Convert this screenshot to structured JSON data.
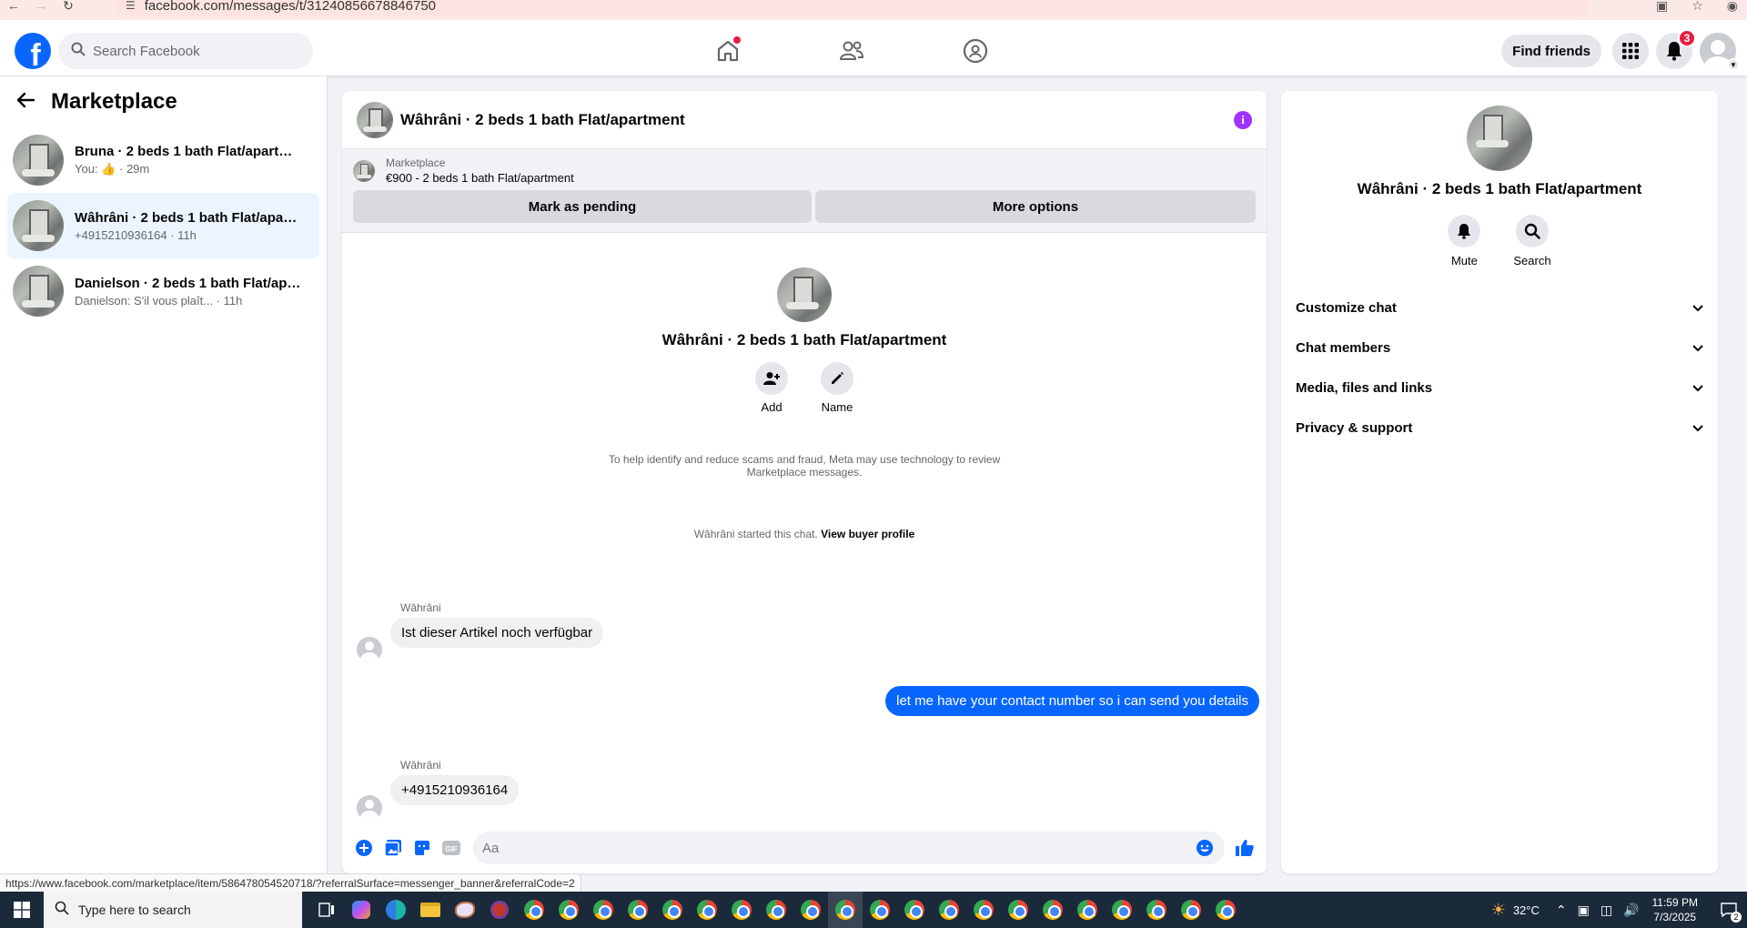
{
  "browser": {
    "url": "facebook.com/messages/t/31240856678846750",
    "status_url": "https://www.facebook.com/marketplace/item/586478054520718/?referralSurface=messenger_banner&referralCode=2"
  },
  "topbar": {
    "search_placeholder": "Search Facebook",
    "find_friends": "Find friends",
    "notifications_count": "3"
  },
  "sidebar": {
    "title": "Marketplace",
    "conversations": [
      {
        "title": "Bruna · 2 beds 1 bath Flat/apartme...",
        "sub_prefix": "You:",
        "sub_time": "· 29m"
      },
      {
        "title": "Wâhrâni · 2 beds 1 bath Flat/apart...",
        "sub": "+4915210936164 · 11h"
      },
      {
        "title": "Danielson · 2 beds 1 bath Flat/apar...",
        "sub": "Danielson: S'il vous plaît... · 11h"
      }
    ]
  },
  "chat": {
    "title": "Wâhrâni · 2 beds 1 bath Flat/apartment",
    "banner_label": "Marketplace",
    "banner_listing": "€900 - 2 beds 1 bath Flat/apartment",
    "mark_pending": "Mark as pending",
    "more_options": "More options",
    "intro_name": "Wâhrâni · 2 beds 1 bath Flat/apartment",
    "intro_add": "Add",
    "intro_name_btn": "Name",
    "started_text": "Wâhrâni started this chat.",
    "view_buyer": "View buyer profile",
    "scam_notice_1": "To help identify and reduce scams and fraud, Meta may use technology to review",
    "scam_notice_2": "Marketplace messages.",
    "messages": [
      {
        "sender": "Wâhrâni",
        "text": "Ist dieser Artikel noch verfügbar",
        "direction": "in"
      },
      {
        "text": "let me have your contact number so i can send you details",
        "direction": "out"
      },
      {
        "sender": "Wâhrâni",
        "text": "+4915210936164",
        "direction": "in"
      }
    ],
    "composer_placeholder": "Aa"
  },
  "info": {
    "name": "Wâhrâni · 2 beds 1 bath Flat/apartment",
    "mute": "Mute",
    "search": "Search",
    "sections": [
      "Customize chat",
      "Chat members",
      "Media, files and links",
      "Privacy & support"
    ]
  },
  "taskbar": {
    "search_placeholder": "Type here to search",
    "temperature": "32°C",
    "time": "11:59 PM",
    "date": "7/3/2025",
    "notif_count": "2"
  },
  "colors": {
    "fb_blue": "#0866ff",
    "info_purple": "#a033ff",
    "badge_red": "#e41e3f"
  }
}
